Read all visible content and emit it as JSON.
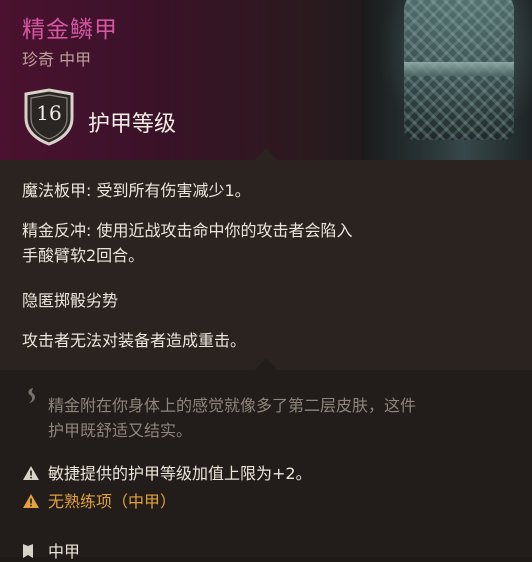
{
  "item": {
    "name": "精金鳞甲",
    "subtitle": "珍奇 中甲",
    "armor_class_value": "16",
    "armor_class_label": "护甲等级"
  },
  "properties": [
    "魔法板甲: 受到所有伤害减少1。",
    "精金反冲: 使用近战攻击命中你的攻击者会陷入",
    "手酸臂软2回合。",
    "隐匿掷骰劣势",
    "攻击者无法对装备者造成重击。"
  ],
  "flavor_text": {
    "line1": "精金附在你身体上的感觉就像多了第二层皮肤，这件",
    "line2": "护甲既舒适又结实。"
  },
  "warnings": [
    {
      "text": "敏捷提供的护甲等级加值上限为+2。",
      "icon": "warning-icon-white",
      "color": "#ece5db"
    },
    {
      "text": "无熟练项（中甲）",
      "icon": "warning-icon-orange",
      "color": "#e0a23c"
    }
  ],
  "footer": {
    "category": "中甲",
    "icon": "armor-type-icon"
  },
  "colors": {
    "rarity_title": "#d455a0",
    "subtitle": "#bfa09a",
    "warning_orange": "#e0a23c",
    "flavor_gray": "#8f857c"
  }
}
